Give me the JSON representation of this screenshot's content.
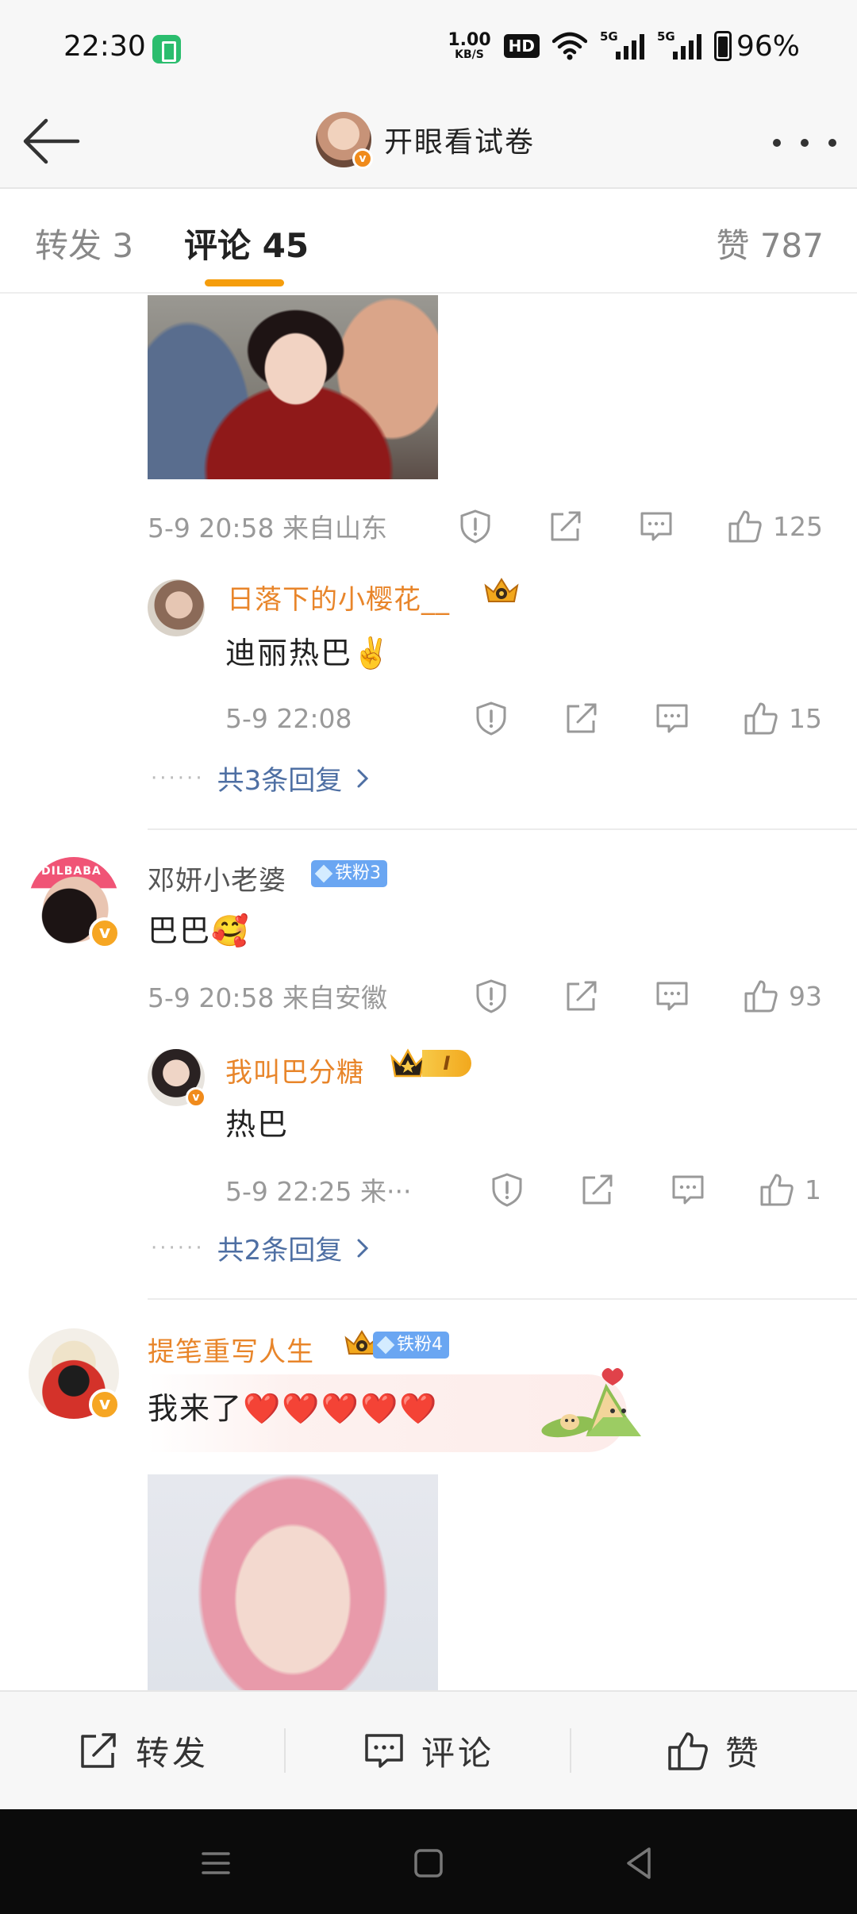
{
  "status_bar": {
    "time": "22:30",
    "net_speed_value": "1.00",
    "net_speed_unit": "KB/S",
    "hd_label": "HD",
    "signal_1_label": "5G",
    "signal_2_label": "5G",
    "battery_percent": "96%"
  },
  "header": {
    "title": "开眼看试卷",
    "verified_mark": "v"
  },
  "tabs": {
    "repost": "转发 3",
    "comments": "评论 45",
    "likes": "赞 787",
    "active": "comments",
    "accent_color": "#f59d0c"
  },
  "comments": [
    {
      "has_image": true,
      "time_location": "5-9 20:58 来自山东",
      "like_count": "125",
      "replies": [
        {
          "username": "日落下的小樱花__",
          "text": "迪丽热巴✌️",
          "time": "5-9 22:08",
          "like_count": "15"
        }
      ],
      "more_replies": "共3条回复"
    },
    {
      "username": "邓妍小老婆",
      "fan_badge": "铁粉3",
      "avatar_text": "DILBABA",
      "text": "巴巴🥰",
      "time_location": "5-9 20:58 来自安徽",
      "like_count": "93",
      "replies": [
        {
          "username": "我叫巴分糖",
          "vip_level": "I",
          "text": "热巴",
          "time": "5-9 22:25 来···",
          "like_count": "1"
        }
      ],
      "more_replies": "共2条回复"
    },
    {
      "username": "提笔重写人生",
      "fan_badge": "铁粉4",
      "text": "我来了❤️❤️❤️❤️❤️",
      "has_image": true
    }
  ],
  "bottom_bar": {
    "repost": "转发",
    "comment": "评论",
    "like": "赞"
  },
  "colors": {
    "username_orange": "#e8852a",
    "link_blue": "#4e6fa3",
    "verified_orange": "#f6a623",
    "fan_badge_blue": "#6aa6f2"
  }
}
